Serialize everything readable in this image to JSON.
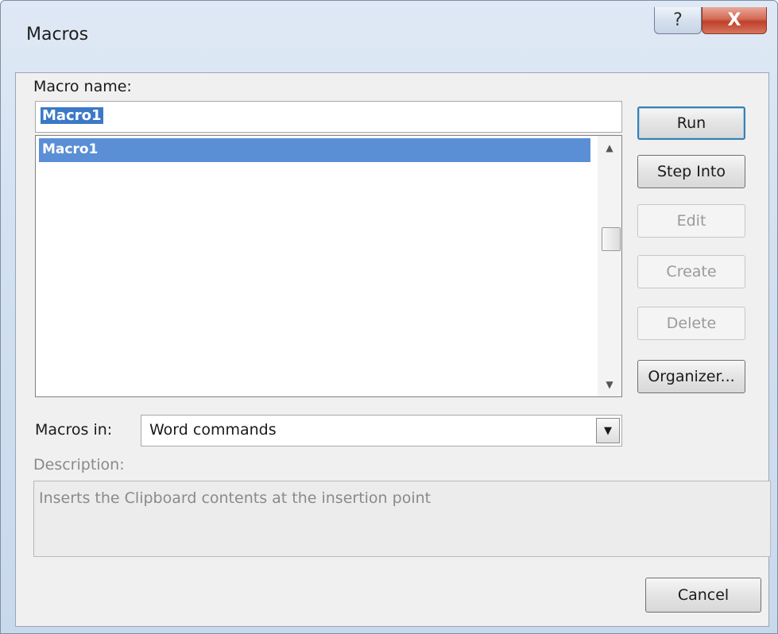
{
  "window": {
    "title": "Macros",
    "help_glyph": "?",
    "close_glyph": "X"
  },
  "macro_name": {
    "label": "Macro name:",
    "value": "Macro1"
  },
  "macro_list": {
    "items": [
      "Macro1"
    ],
    "selected_index": 0
  },
  "buttons": {
    "run": "Run",
    "step_into": "Step Into",
    "edit": "Edit",
    "create": "Create",
    "delete": "Delete",
    "organizer": "Organizer...",
    "cancel": "Cancel"
  },
  "macros_in": {
    "label": "Macros in:",
    "value": "Word commands"
  },
  "description": {
    "label": "Description:",
    "text": "Inserts the Clipboard contents at the insertion point"
  },
  "colors": {
    "selection": "#5a8fd6",
    "close_button": "#c0402a",
    "default_button_border": "#3c7fb1"
  },
  "icons": {
    "help": "help-icon",
    "close": "close-icon",
    "scroll_up": "scroll-up-arrow-icon",
    "scroll_down": "scroll-down-arrow-icon",
    "dropdown": "chevron-down-icon"
  }
}
